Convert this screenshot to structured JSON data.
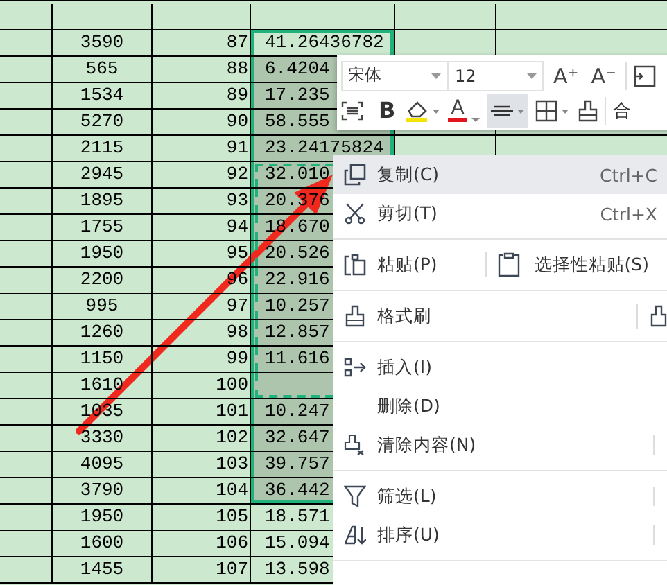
{
  "sheet": {
    "rows": [
      {
        "b": "3590",
        "c": "87",
        "d": "41.26436782",
        "selected": true,
        "copied": false
      },
      {
        "b": "565",
        "c": "88",
        "d": "6.4204",
        "selected": true,
        "copied": false
      },
      {
        "b": "1534",
        "c": "89",
        "d": "17.235",
        "selected": true,
        "copied": false
      },
      {
        "b": "5270",
        "c": "90",
        "d": "58.555",
        "selected": true,
        "copied": false
      },
      {
        "b": "2115",
        "c": "91",
        "d": "23.24175824",
        "selected": true,
        "copied": false
      },
      {
        "b": "2945",
        "c": "92",
        "d": "32.010",
        "selected": true,
        "copied": true
      },
      {
        "b": "1895",
        "c": "93",
        "d": "20.376",
        "selected": true,
        "copied": true
      },
      {
        "b": "1755",
        "c": "94",
        "d": "18.670",
        "selected": true,
        "copied": true
      },
      {
        "b": "1950",
        "c": "95",
        "d": "20.526",
        "selected": true,
        "copied": true
      },
      {
        "b": "2200",
        "c": "96",
        "d": "22.916",
        "selected": true,
        "copied": true
      },
      {
        "b": "995",
        "c": "97",
        "d": "10.257",
        "selected": true,
        "copied": true
      },
      {
        "b": "1260",
        "c": "98",
        "d": "12.857",
        "selected": true,
        "copied": true
      },
      {
        "b": "1150",
        "c": "99",
        "d": "11.616",
        "selected": true,
        "copied": true
      },
      {
        "b": "1610",
        "c": "100",
        "selected": true,
        "copied": true
      },
      {
        "b": "1035",
        "c": "101",
        "d": "10.247",
        "selected": true,
        "copied": false
      },
      {
        "b": "3330",
        "c": "102",
        "d": "32.647",
        "selected": true,
        "copied": false
      },
      {
        "b": "4095",
        "c": "103",
        "d": "39.757",
        "selected": true,
        "copied": false
      },
      {
        "b": "3790",
        "c": "104",
        "d": "36.442",
        "selected": true,
        "copied": false
      },
      {
        "b": "1950",
        "c": "105",
        "d": "18.571",
        "selected": false,
        "copied": false
      },
      {
        "b": "1600",
        "c": "106",
        "d": "15.094",
        "selected": false,
        "copied": false
      },
      {
        "b": "1455",
        "c": "107",
        "d": "13.598",
        "selected": false,
        "copied": false
      }
    ]
  },
  "toolbar": {
    "font": "宋体",
    "size": "12",
    "grow": "A⁺",
    "shrink": "A⁻",
    "bold": "B",
    "font_color": "A",
    "align_selected": true,
    "merge": "合"
  },
  "menu": [
    {
      "kind": "item",
      "label": "复制(C)",
      "shortcut": "Ctrl+C",
      "selected": true
    },
    {
      "kind": "item",
      "label": "剪切(T)",
      "shortcut": "Ctrl+X",
      "selected": false
    },
    {
      "kind": "separator"
    },
    {
      "kind": "split",
      "label": "粘贴(P)",
      "extra": "选择性粘贴(S)",
      "selected": false
    },
    {
      "kind": "separator"
    },
    {
      "kind": "split",
      "label": "格式刷",
      "selected": false
    },
    {
      "kind": "separator"
    },
    {
      "kind": "item",
      "label": "插入(I)",
      "selected": false
    },
    {
      "kind": "item",
      "label": "删除(D)",
      "selected": false
    },
    {
      "kind": "submenu",
      "label": "清除内容(N)",
      "selected": false
    },
    {
      "kind": "separator"
    },
    {
      "kind": "submenu",
      "label": "筛选(L)",
      "selected": false
    },
    {
      "kind": "submenu",
      "label": "排序(U)",
      "selected": false
    },
    {
      "kind": "separator"
    }
  ]
}
